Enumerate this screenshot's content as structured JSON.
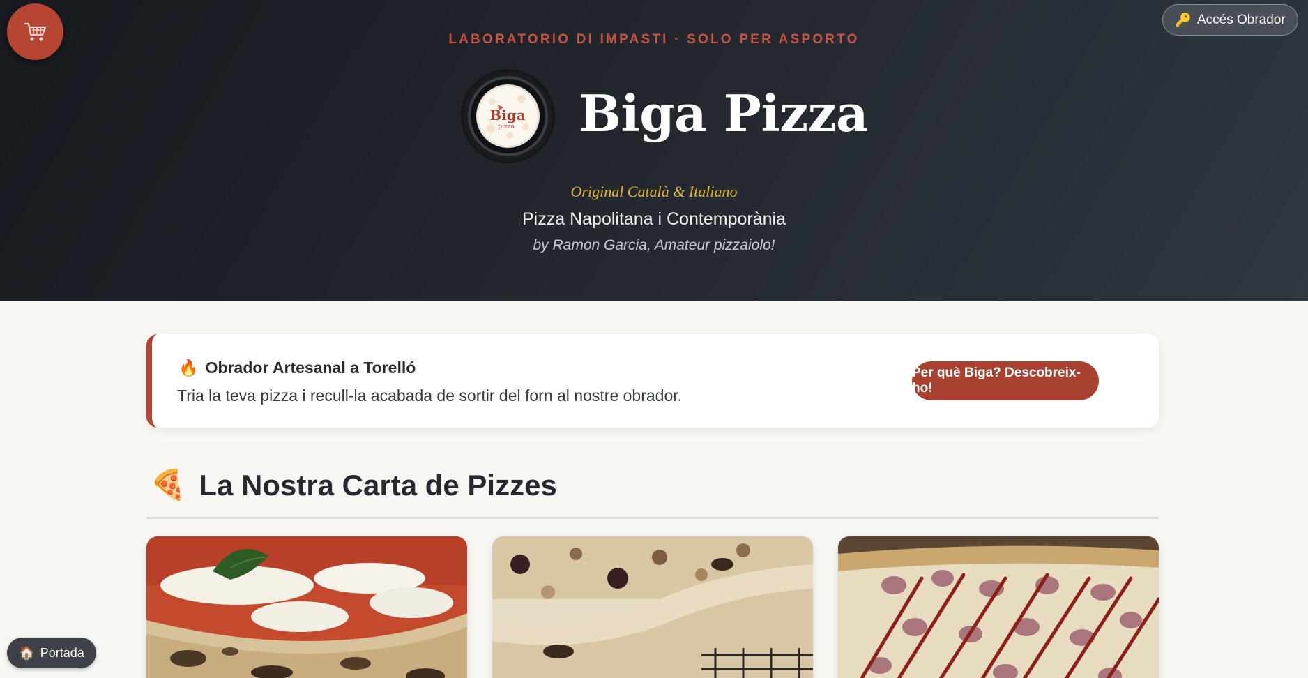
{
  "header": {
    "tagline": "LABORATORIO DI IMPASTI · SOLO PER ASPORTO",
    "brand": "Biga Pizza",
    "logo_text_main": "Biga",
    "logo_text_sub": "pizza",
    "origin": "Original Català & Italiano",
    "subtitle": "Pizza Napolitana i Contemporània",
    "byline": "by Ramon Garcia, Amateur pizzaiolo!"
  },
  "floating": {
    "cart_icon": "cart-icon",
    "access_label": "Accés Obrador",
    "access_icon": "🔑",
    "home_label": "Portada",
    "home_icon": "🏠"
  },
  "info": {
    "icon": "🔥",
    "title": "Obrador Artesanal a Torelló",
    "text": "Tria la teva pizza i recull-la acabada de sortir del forn al nostre obrador.",
    "button": "Per què Biga? Descobreix-ho!"
  },
  "menu": {
    "icon": "🍕",
    "title": "La Nostra Carta de Pizzes"
  },
  "colors": {
    "accent": "#b54433",
    "gold": "#e7b93d",
    "header_dark": "#1c2026",
    "page_bg": "#f8f6f2"
  }
}
